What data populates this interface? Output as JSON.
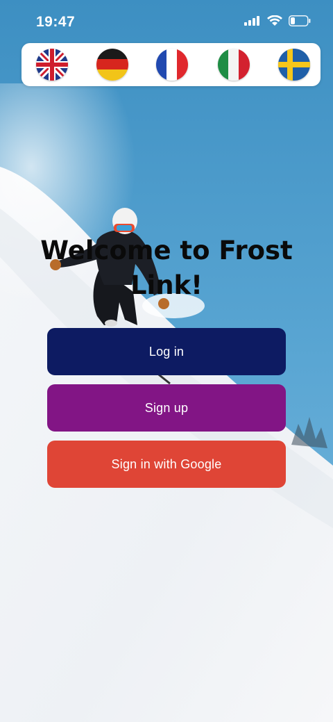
{
  "status_bar": {
    "time": "19:47",
    "signal_icon": "cellular-signal-icon",
    "wifi_icon": "wifi-icon",
    "battery_icon": "battery-icon"
  },
  "languages": [
    {
      "flag_icon": "uk-flag-icon",
      "language": "English"
    },
    {
      "flag_icon": "germany-flag-icon",
      "language": "German"
    },
    {
      "flag_icon": "france-flag-icon",
      "language": "French"
    },
    {
      "flag_icon": "italy-flag-icon",
      "language": "Italian"
    },
    {
      "flag_icon": "sweden-flag-icon",
      "language": "Swedish"
    }
  ],
  "welcome": {
    "title": "Welcome to Frost Link!"
  },
  "buttons": {
    "login": "Log in",
    "signup": "Sign up",
    "google": "Sign in with Google"
  },
  "colors": {
    "login": "#0d1b62",
    "signup": "#821585",
    "google": "#df4536"
  }
}
